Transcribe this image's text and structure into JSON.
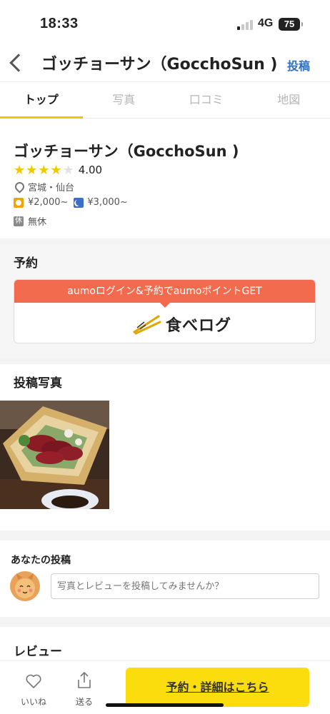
{
  "status_bar": {
    "time": "18:33",
    "network": "4G",
    "battery": "75"
  },
  "header": {
    "title": "ゴッチョーサン（GocchoSun )",
    "post_label": "投稿"
  },
  "tabs": [
    {
      "label": "トップ",
      "active": true
    },
    {
      "label": "写真",
      "active": false
    },
    {
      "label": "口コミ",
      "active": false
    },
    {
      "label": "地図",
      "active": false
    }
  ],
  "shop": {
    "name": "ゴッチョーサン（GocchoSun )",
    "rating": {
      "value": 4.0,
      "text": "4.00",
      "max": 5
    },
    "area": "宮城・仙台",
    "lunch_price": "¥2,000~",
    "dinner_price": "¥3,000~",
    "holiday_icon": "休",
    "holiday": "無休"
  },
  "reservation": {
    "section_title": "予約",
    "banner": "aumoログイン&予約でaumoポイントGET",
    "partner_logo_text": "食べログ"
  },
  "photos": {
    "section_title": "投稿写真"
  },
  "your_post": {
    "title": "あなたの投稿",
    "placeholder": "写真とレビューを投稿してみませんか？"
  },
  "reviews": {
    "section_title": "レビュー"
  },
  "bottom_bar": {
    "like_label": "いいね",
    "share_label": "送る",
    "cta_label": "予約・詳細はこちら"
  },
  "colors": {
    "accent": "#f3c400",
    "link": "#2c70c4",
    "banner": "#f36b4e",
    "cta": "#fbdc0d",
    "star": "#f2c600"
  },
  "icons": [
    "back-chevron-icon",
    "location-pin-icon",
    "lunch-sun-icon",
    "dinner-moon-icon",
    "holiday-icon",
    "chopsticks-icon",
    "heart-icon",
    "share-icon"
  ]
}
